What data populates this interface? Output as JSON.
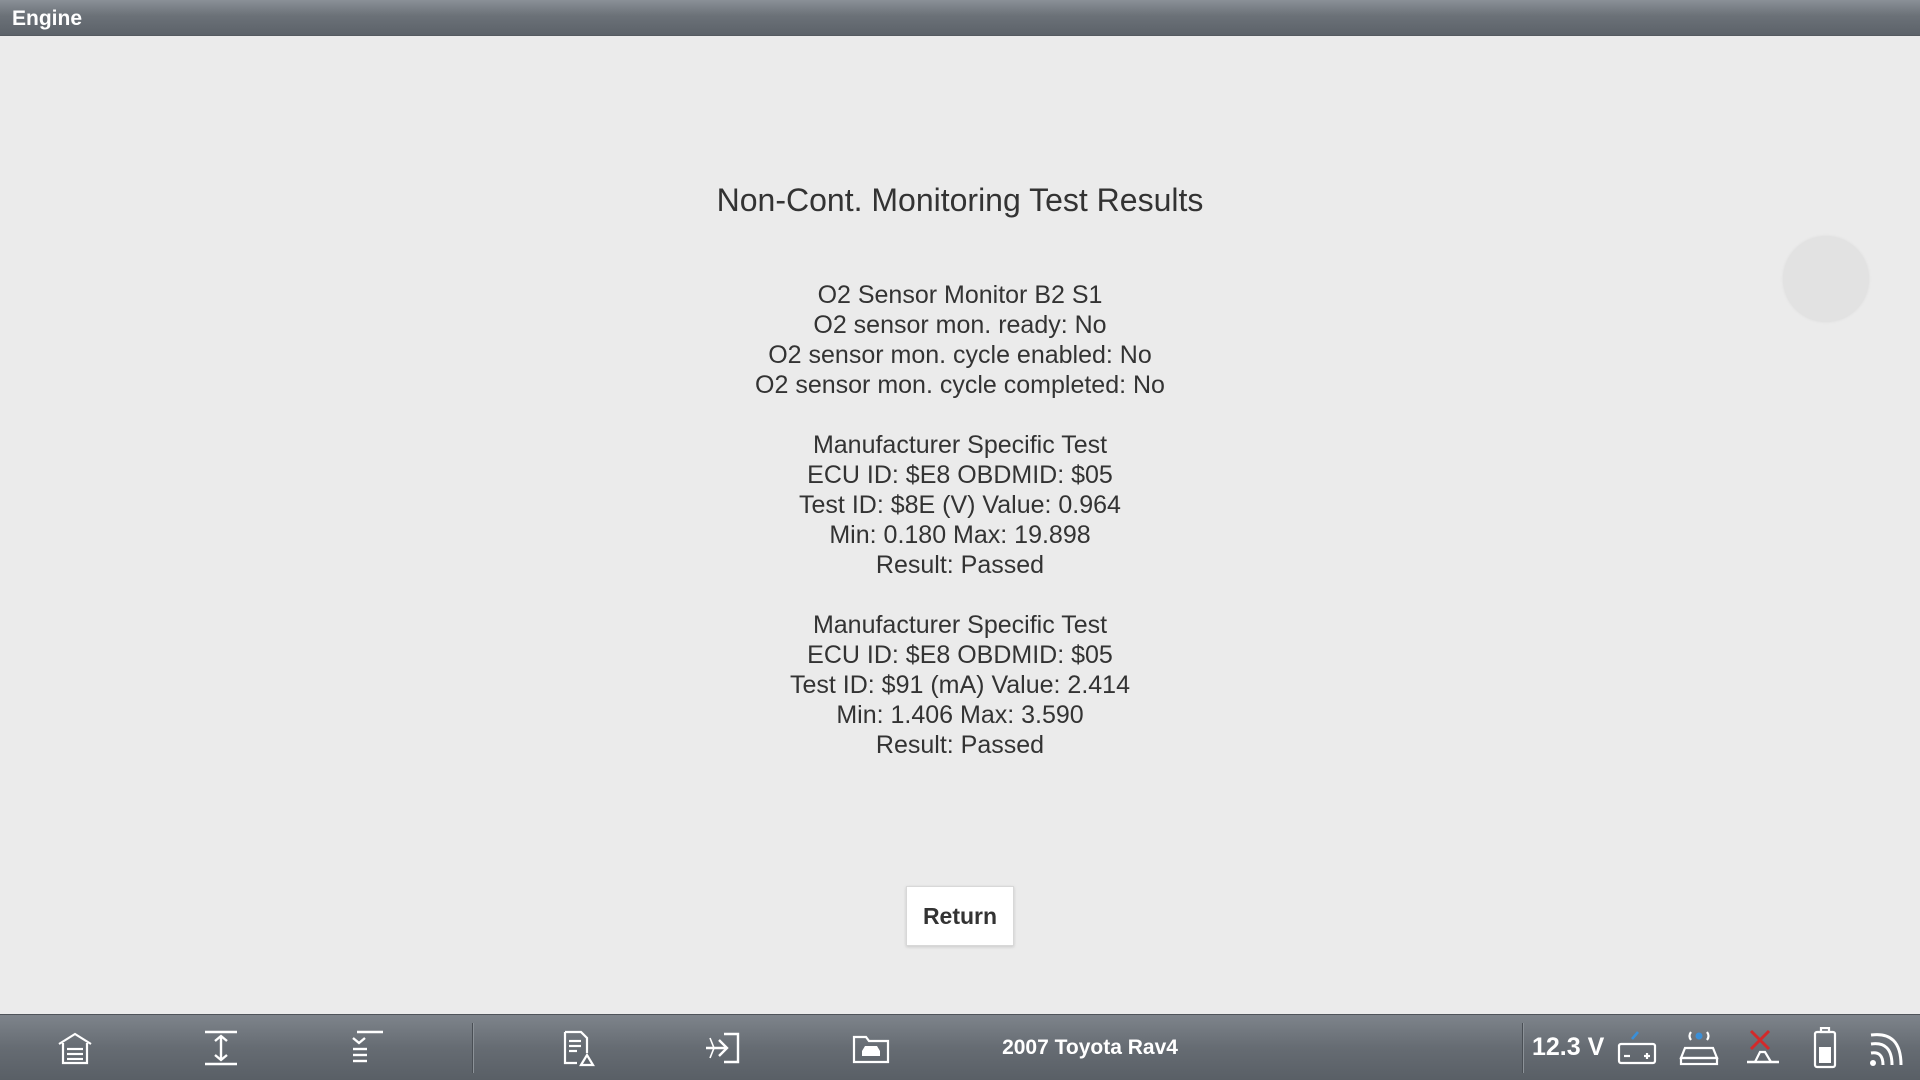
{
  "titlebar": {
    "title": "Engine"
  },
  "report": {
    "title": "Non-Cont. Monitoring Test Results",
    "blocks": [
      {
        "lines": [
          "O2 Sensor Monitor B2 S1",
          "O2 sensor mon. ready: No",
          "O2 sensor mon. cycle enabled: No",
          "O2 sensor mon. cycle completed: No"
        ]
      },
      {
        "lines": [
          "Manufacturer Specific Test",
          "ECU ID: $E8 OBDMID: $05",
          "Test ID: $8E (V) Value: 0.964",
          "Min: 0.180 Max: 19.898",
          "Result: Passed"
        ]
      },
      {
        "lines": [
          "Manufacturer Specific Test",
          "ECU ID: $E8 OBDMID: $05",
          "Test ID: $91 (mA) Value: 2.414",
          "Min: 1.406 Max: 3.590",
          "Result: Passed"
        ]
      }
    ]
  },
  "actions": {
    "return_label": "Return"
  },
  "taskbar": {
    "vehicle": "2007 Toyota Rav4",
    "voltage": "12.3 V",
    "icons": {
      "home": "home-garage-icon",
      "expand": "expand-icon",
      "collapse": "collapse-icon",
      "report": "report-icon",
      "exit": "exit-icon",
      "vehicle": "vehicle-icon",
      "battery_connection": "battery-connection-icon",
      "vci": "vci-icon",
      "disconnected": "disconnected-icon",
      "battery": "battery-icon",
      "wifi": "wifi-icon"
    },
    "colors": {
      "disconnected_red": "#d42a2a",
      "accent_blue": "#3a8fd8"
    }
  }
}
